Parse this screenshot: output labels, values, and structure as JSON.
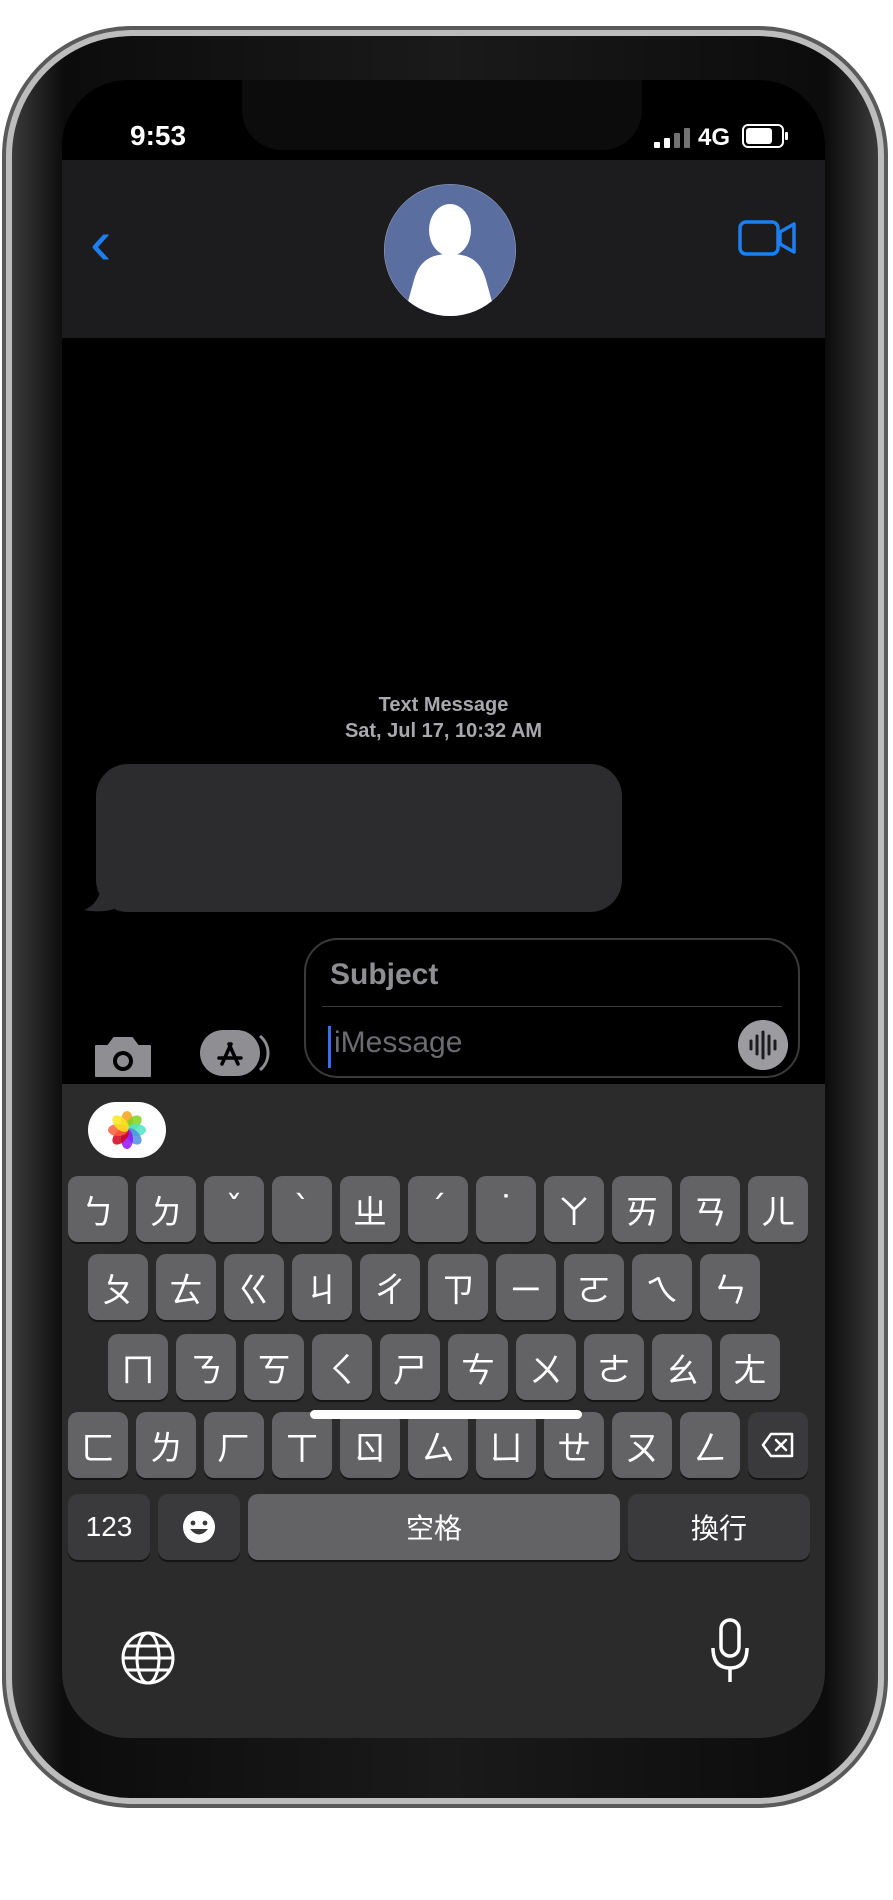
{
  "status": {
    "time": "9:53",
    "network": "4G"
  },
  "conversation": {
    "meta_line1": "Text Message",
    "meta_line2": "Sat, Jul 17, 10:32 AM"
  },
  "compose": {
    "subject": "Subject",
    "placeholder": "iMessage"
  },
  "keyboard": {
    "row1": [
      "ㄅ",
      "ㄉ",
      "ˇ",
      "ˋ",
      "ㄓ",
      "ˊ",
      "˙",
      "ㄚ",
      "ㄞ",
      "ㄢ",
      "ㄦ"
    ],
    "row2": [
      "ㄆ",
      "ㄊ",
      "ㄍ",
      "ㄐ",
      "ㄔ",
      "ㄗ",
      "ㄧ",
      "ㄛ",
      "ㄟ",
      "ㄣ"
    ],
    "row3": [
      "ㄇ",
      "ㄋ",
      "ㄎ",
      "ㄑ",
      "ㄕ",
      "ㄘ",
      "ㄨ",
      "ㄜ",
      "ㄠ",
      "ㄤ"
    ],
    "row4": [
      "ㄈ",
      "ㄌ",
      "ㄏ",
      "ㄒ",
      "ㄖ",
      "ㄙ",
      "ㄩ",
      "ㄝ",
      "ㄡ",
      "ㄥ"
    ],
    "num_label": "123",
    "space_label": "空格",
    "return_label": "換行"
  },
  "colors": {
    "accent": "#1d7ef0",
    "background": "#000000",
    "bubble": "#2c2c2e",
    "key": "#636366"
  }
}
